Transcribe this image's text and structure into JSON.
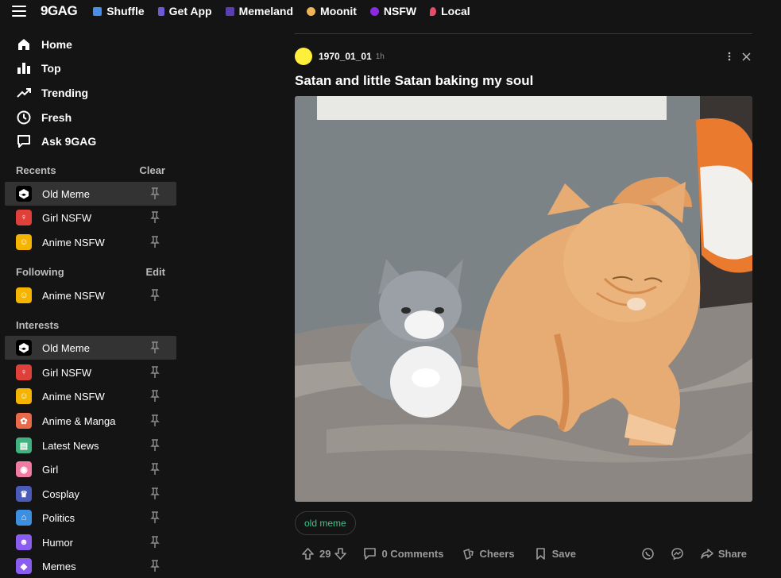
{
  "header": {
    "logo": "9GAG",
    "nav": [
      {
        "label": "Shuffle",
        "icon": "shuffle-icon",
        "color": "#4a8fe7"
      },
      {
        "label": "Get App",
        "icon": "phone-icon",
        "color": "#6b5bd6"
      },
      {
        "label": "Memeland",
        "icon": "memeland-icon",
        "color": "#5a3fb0"
      },
      {
        "label": "Moonit",
        "icon": "moonit-icon",
        "color": "#f0b35a"
      },
      {
        "label": "NSFW",
        "icon": "nsfw-icon",
        "color": "#8a2be2"
      },
      {
        "label": "Local",
        "icon": "pin-icon",
        "color": "#e84b6b"
      }
    ]
  },
  "sidebar": {
    "main": [
      {
        "label": "Home",
        "icon": "home-icon"
      },
      {
        "label": "Top",
        "icon": "bar-chart-icon"
      },
      {
        "label": "Trending",
        "icon": "trending-icon"
      },
      {
        "label": "Fresh",
        "icon": "clock-icon"
      },
      {
        "label": "Ask 9GAG",
        "icon": "chat-icon"
      }
    ],
    "recents": {
      "title": "Recents",
      "action": "Clear",
      "items": [
        {
          "label": "Old Meme",
          "icon": "9gag-icon",
          "bg": "#000000",
          "active": true
        },
        {
          "label": "Girl NSFW",
          "icon": "girl-nsfw-icon",
          "bg": "#e0403a"
        },
        {
          "label": "Anime NSFW",
          "icon": "anime-nsfw-icon",
          "bg": "#f5b400"
        }
      ]
    },
    "following": {
      "title": "Following",
      "action": "Edit",
      "items": [
        {
          "label": "Anime NSFW",
          "icon": "anime-nsfw-icon",
          "bg": "#f5b400"
        }
      ]
    },
    "interests": {
      "title": "Interests",
      "items": [
        {
          "label": "Old Meme",
          "icon": "9gag-icon",
          "bg": "#000000",
          "active": true
        },
        {
          "label": "Girl NSFW",
          "icon": "girl-nsfw-icon",
          "bg": "#e0403a"
        },
        {
          "label": "Anime NSFW",
          "icon": "anime-nsfw-icon",
          "bg": "#f5b400"
        },
        {
          "label": "Anime & Manga",
          "icon": "anime-manga-icon",
          "bg": "#e86a4a"
        },
        {
          "label": "Latest News",
          "icon": "news-icon",
          "bg": "#3fb27f"
        },
        {
          "label": "Girl",
          "icon": "lips-icon",
          "bg": "#f07aa0"
        },
        {
          "label": "Cosplay",
          "icon": "cosplay-icon",
          "bg": "#4b5bb8"
        },
        {
          "label": "Politics",
          "icon": "politics-icon",
          "bg": "#3d8fe0"
        },
        {
          "label": "Humor",
          "icon": "humor-icon",
          "bg": "#8a5cf0"
        },
        {
          "label": "Memes",
          "icon": "memes-icon",
          "bg": "#8a5cf0"
        }
      ]
    }
  },
  "post": {
    "username": "1970_01_01",
    "time": "1h",
    "title": "Satan and little Satan baking my soul",
    "tag": "old meme",
    "upvotes": "29",
    "comments": "0 Comments",
    "cheers": "Cheers",
    "save": "Save",
    "share": "Share",
    "avatar_color": "#ffef3d",
    "tag_color": "#35c98a"
  }
}
